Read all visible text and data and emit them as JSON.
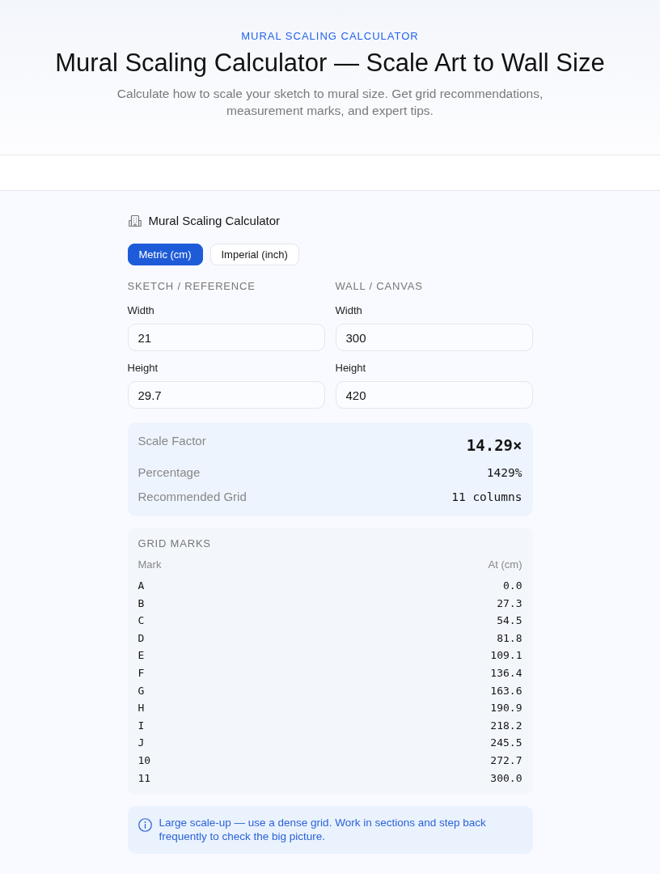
{
  "header": {
    "eyebrow": "MURAL SCALING CALCULATOR",
    "title": "Mural Scaling Calculator — Scale Art to Wall Size",
    "subtitle": "Calculate how to scale your sketch to mural size. Get grid recommendations, measurement marks, and expert tips."
  },
  "calculator": {
    "title": "Mural Scaling Calculator",
    "unit_tabs": [
      {
        "label": "Metric (cm)",
        "selected": true
      },
      {
        "label": "Imperial (inch)",
        "selected": false
      }
    ],
    "sections": [
      {
        "heading": "SKETCH / REFERENCE",
        "fields": [
          {
            "label": "Width",
            "value": "21"
          },
          {
            "label": "Height",
            "value": "29.7"
          }
        ]
      },
      {
        "heading": "WALL / CANVAS",
        "fields": [
          {
            "label": "Width",
            "value": "300"
          },
          {
            "label": "Height",
            "value": "420"
          }
        ]
      }
    ],
    "results": [
      {
        "kind": "primary",
        "label": "Scale Factor",
        "value": "14.29×"
      },
      {
        "kind": "normal",
        "label": "Percentage",
        "value": "1429%"
      },
      {
        "kind": "normal",
        "label": "Recommended Grid",
        "value": "11 columns"
      }
    ],
    "grid_marks": {
      "heading": "GRID MARKS",
      "columns": [
        "Mark",
        "At (cm)"
      ],
      "rows": [
        {
          "mark": "A",
          "at": "0.0"
        },
        {
          "mark": "B",
          "at": "27.3"
        },
        {
          "mark": "C",
          "at": "54.5"
        },
        {
          "mark": "D",
          "at": "81.8"
        },
        {
          "mark": "E",
          "at": "109.1"
        },
        {
          "mark": "F",
          "at": "136.4"
        },
        {
          "mark": "G",
          "at": "163.6"
        },
        {
          "mark": "H",
          "at": "190.9"
        },
        {
          "mark": "I",
          "at": "218.2"
        },
        {
          "mark": "J",
          "at": "245.5"
        },
        {
          "mark": "10",
          "at": "272.7"
        },
        {
          "mark": "11",
          "at": "300.0"
        }
      ]
    },
    "tip": {
      "text": "Large scale-up — use a dense grid. Work in sections and step back frequently to check the big picture."
    }
  }
}
